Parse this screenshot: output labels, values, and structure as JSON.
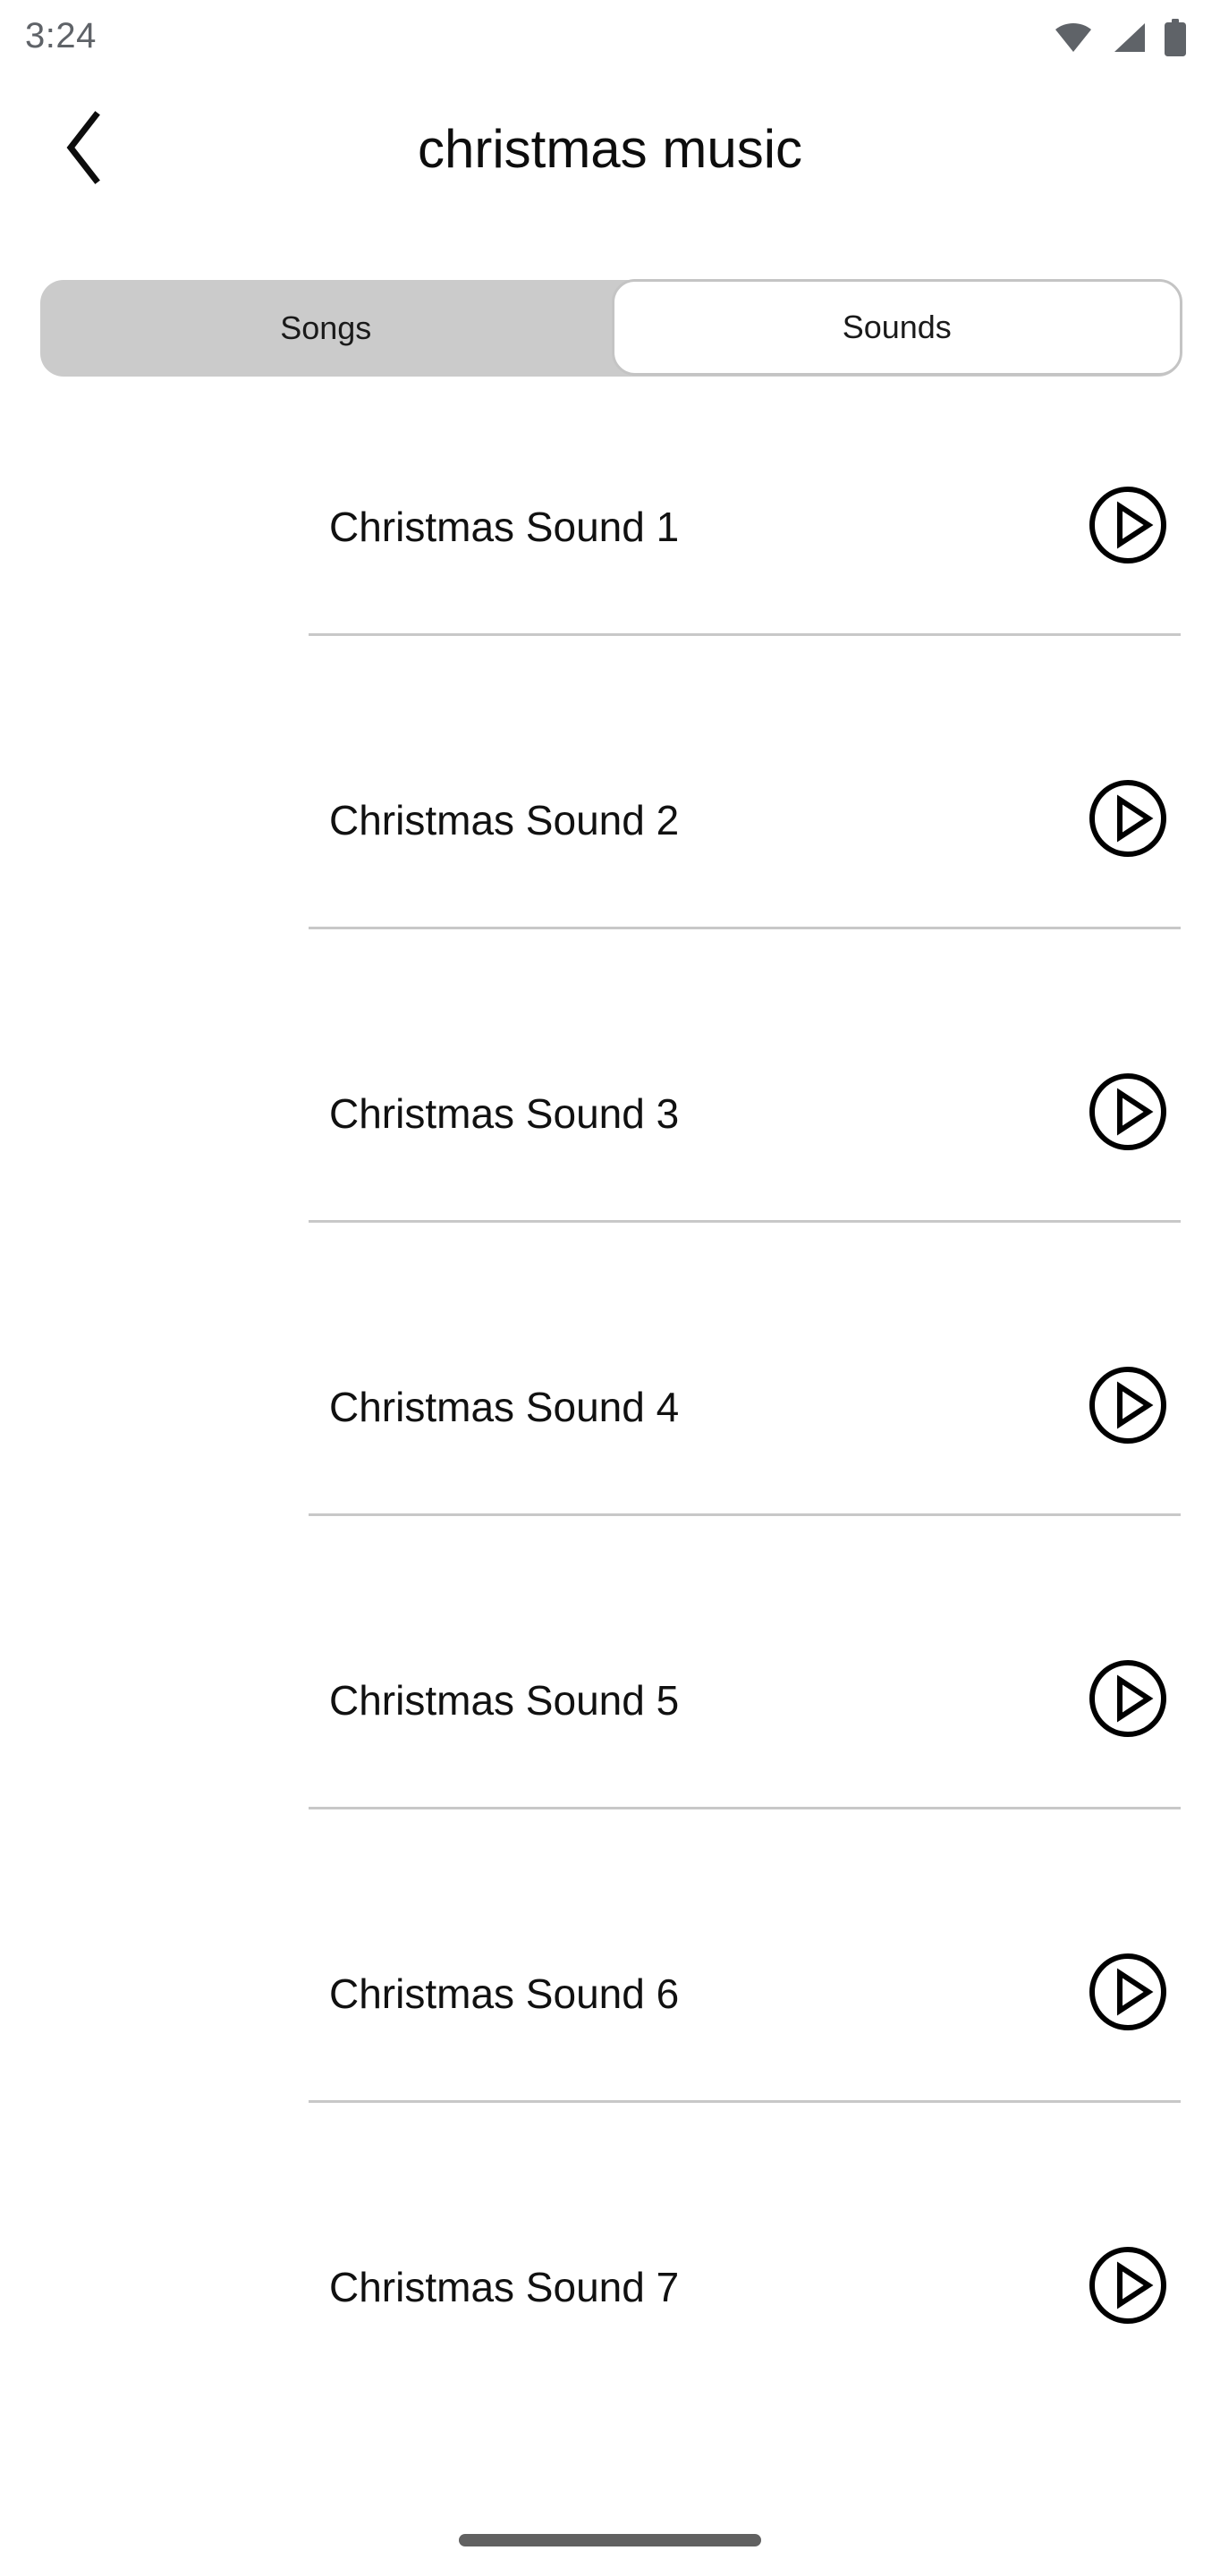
{
  "status_bar": {
    "time": "3:24",
    "icons": [
      "wifi-icon",
      "cellular-signal-icon",
      "battery-icon"
    ],
    "icon_color": "#5f6368"
  },
  "header": {
    "back_icon": "chevron-left-icon",
    "title": "christmas music"
  },
  "tabs": {
    "track_color": "#cbcbcb",
    "selected_index": 1,
    "items": [
      {
        "label": "Songs",
        "selected": false
      },
      {
        "label": "Sounds",
        "selected": true
      }
    ]
  },
  "list": {
    "play_icon": "play-circle-icon",
    "divider_color": "#c8c8c8",
    "items": [
      {
        "label": "Christmas Sound 1"
      },
      {
        "label": "Christmas Sound 2"
      },
      {
        "label": "Christmas Sound 3"
      },
      {
        "label": "Christmas Sound 4"
      },
      {
        "label": "Christmas Sound 5"
      },
      {
        "label": "Christmas Sound 6"
      },
      {
        "label": "Christmas Sound 7"
      }
    ]
  },
  "gesture_bar": {
    "name": "home-indicator",
    "color": "#616161"
  }
}
